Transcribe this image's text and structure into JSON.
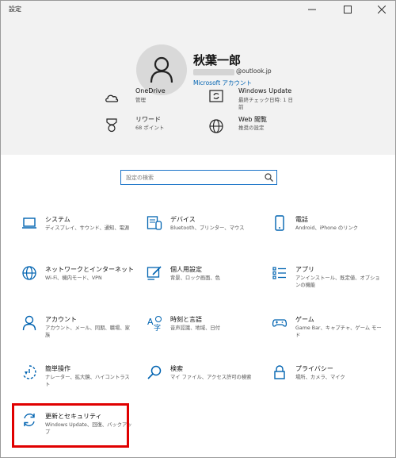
{
  "window": {
    "title": "設定"
  },
  "controls": {
    "minimize": "─",
    "maximize": "☐",
    "close": "✕"
  },
  "user": {
    "name": "秋葉一郎",
    "email_suffix": "@outlook.jp",
    "account_link": "Microsoft アカウント"
  },
  "quick": [
    {
      "title": "OneDrive",
      "sub": "管理",
      "icon": "cloud-icon"
    },
    {
      "title": "Windows Update",
      "sub": "最終チェック日時: 1 日前",
      "icon": "update-refresh-icon"
    },
    {
      "title": "リワード",
      "sub": "68 ポイント",
      "icon": "medal-icon"
    },
    {
      "title": "Web 閲覧",
      "sub": "推奨の設定",
      "icon": "globe-icon"
    }
  ],
  "search": {
    "placeholder": "設定の検索"
  },
  "tiles": [
    {
      "title": "システム",
      "sub": "ディスプレイ、サウンド、通知、電源",
      "icon": "laptop-icon"
    },
    {
      "title": "デバイス",
      "sub": "Bluetooth、プリンター、マウス",
      "icon": "devices-icon"
    },
    {
      "title": "電話",
      "sub": "Android、iPhone のリンク",
      "icon": "phone-icon"
    },
    {
      "title": "ネットワークとインターネット",
      "sub": "Wi-Fi、機内モード、VPN",
      "icon": "network-globe-icon"
    },
    {
      "title": "個人用設定",
      "sub": "背景、ロック画面、色",
      "icon": "personalization-icon"
    },
    {
      "title": "アプリ",
      "sub": "アンインストール、既定値、オプションの機能",
      "icon": "apps-list-icon"
    },
    {
      "title": "アカウント",
      "sub": "アカウント、メール、同期、職場、家族",
      "icon": "person-icon"
    },
    {
      "title": "時刻と言語",
      "sub": "音声認識、地域、日付",
      "icon": "time-language-icon"
    },
    {
      "title": "ゲーム",
      "sub": "Game Bar、キャプチャ、ゲーム モード",
      "icon": "gamepad-icon"
    },
    {
      "title": "簡単操作",
      "sub": "ナレーター、拡大鏡、ハイコントラスト",
      "icon": "ease-of-access-icon"
    },
    {
      "title": "検索",
      "sub": "マイ ファイル、アクセス許可の検索",
      "icon": "search-magnifier-icon"
    },
    {
      "title": "プライバシー",
      "sub": "場所、カメラ、マイク",
      "icon": "lock-icon"
    },
    {
      "title": "更新とセキュリティ",
      "sub": "Windows Update、回復、バックアップ",
      "icon": "update-security-icon"
    }
  ],
  "colors": {
    "accent": "#0063b1",
    "highlight": "#e00000",
    "header_bg": "#f2f2f2"
  }
}
